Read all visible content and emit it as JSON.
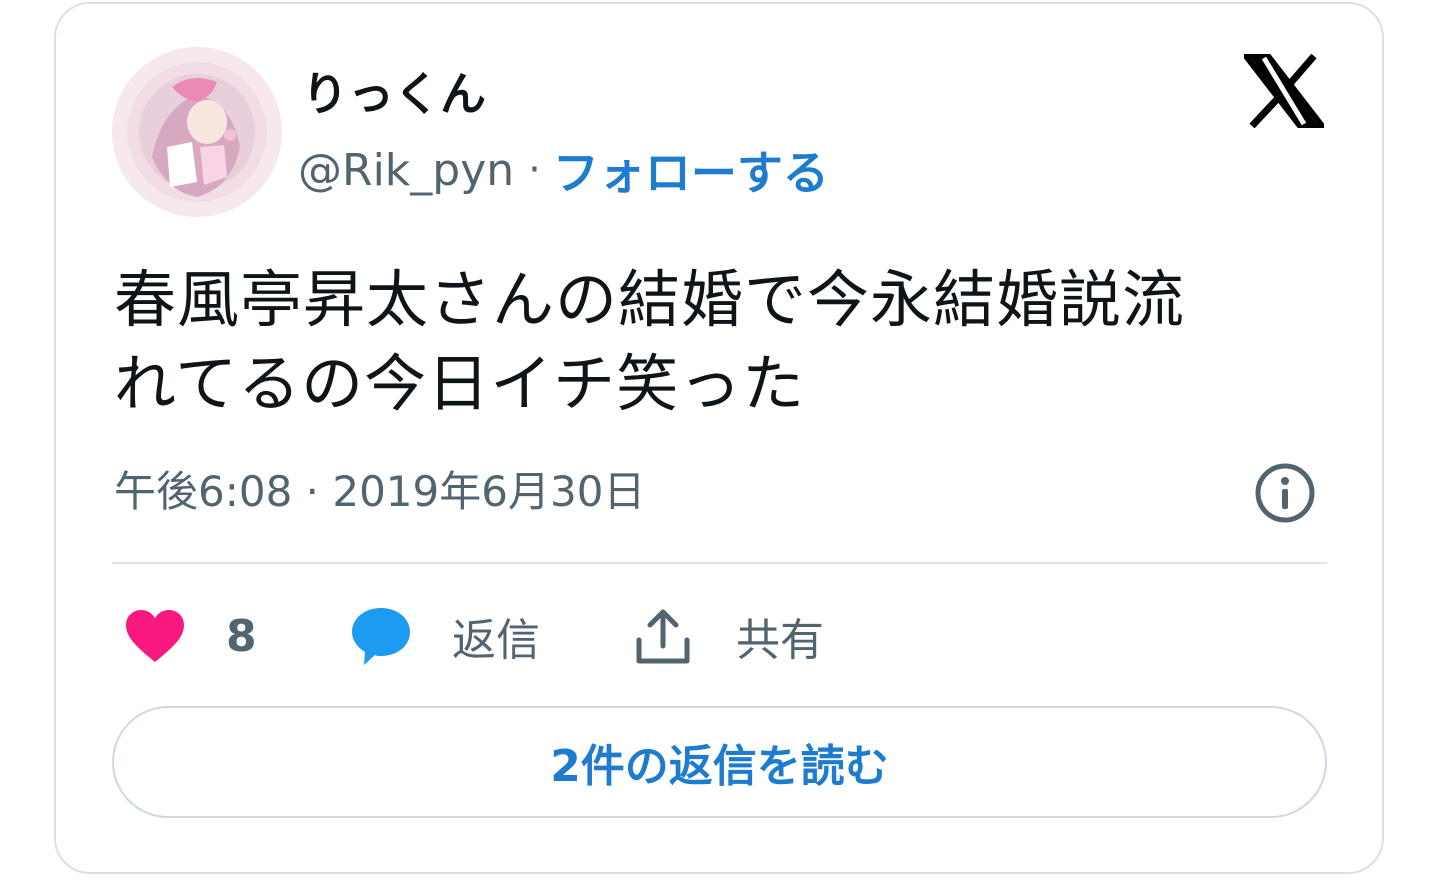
{
  "user": {
    "display_name": "りっくん",
    "handle": "@Rik_pyn",
    "separator": "·",
    "follow_label": "フォローする"
  },
  "tweet": {
    "text_line1": "春風亭昇太さんの結婚で今永結婚説流",
    "text_line2": "れてるの今日イチ笑った",
    "timestamp": "午後6:08 · 2019年6月30日"
  },
  "actions": {
    "like_count": "8",
    "reply_label": "返信",
    "share_label": "共有"
  },
  "read_replies_label": "2件の返信を読む",
  "icons": {
    "brand": "x-logo-icon",
    "info": "info-icon",
    "like": "heart-icon",
    "reply": "speech-bubble-icon",
    "share": "share-upload-icon"
  },
  "colors": {
    "accent": "#1d7bd0",
    "like": "#f91880",
    "reply": "#1d9bf0",
    "text": "#0f1419",
    "muted": "#536471"
  }
}
